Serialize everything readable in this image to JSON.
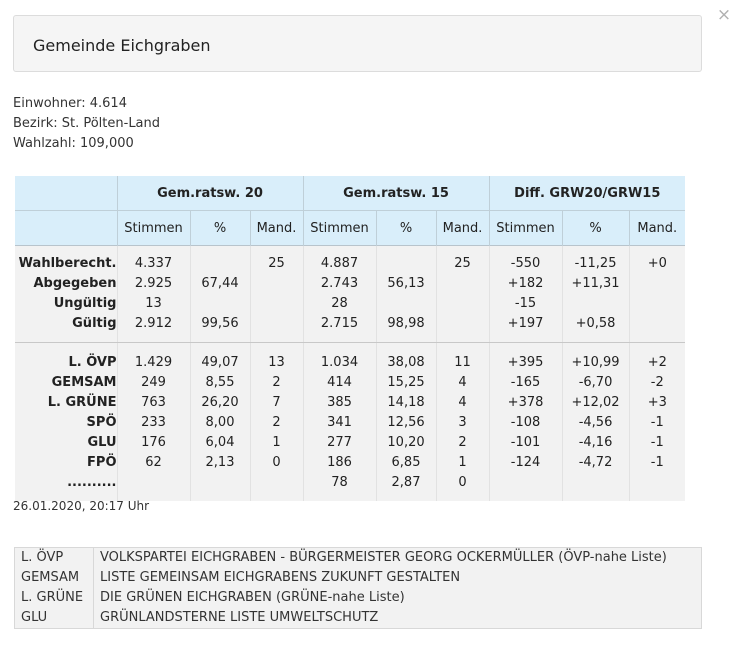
{
  "close_icon": "×",
  "title": "Gemeinde Eichgraben",
  "info": {
    "einwohner": "Einwohner: 4.614",
    "bezirk": "Bezirk: St. Pölten-Land",
    "wahlzahl": "Wahlzahl: 109,000"
  },
  "table": {
    "groups": [
      "Gem.ratsw. 20",
      "Gem.ratsw. 15",
      "Diff. GRW20/GRW15"
    ],
    "columns": [
      "Stimmen",
      "%",
      "Mand.",
      "Stimmen",
      "%",
      "Mand.",
      "Stimmen",
      "%",
      "Mand."
    ],
    "summary_rows": [
      {
        "label": "Wahlberecht.",
        "cells": [
          "4.337",
          "",
          "25",
          "4.887",
          "",
          "25",
          "-550",
          "-11,25",
          "+0"
        ]
      },
      {
        "label": "Abgegeben",
        "cells": [
          "2.925",
          "67,44",
          "",
          "2.743",
          "56,13",
          "",
          "+182",
          "+11,31",
          ""
        ]
      },
      {
        "label": "Ungültig",
        "cells": [
          "13",
          "",
          "",
          "28",
          "",
          "",
          "-15",
          "",
          ""
        ]
      },
      {
        "label": "Gültig",
        "cells": [
          "2.912",
          "99,56",
          "",
          "2.715",
          "98,98",
          "",
          "+197",
          "+0,58",
          ""
        ]
      }
    ],
    "party_rows": [
      {
        "label": "L. ÖVP",
        "cells": [
          "1.429",
          "49,07",
          "13",
          "1.034",
          "38,08",
          "11",
          "+395",
          "+10,99",
          "+2"
        ]
      },
      {
        "label": "GEMSAM",
        "cells": [
          "249",
          "8,55",
          "2",
          "414",
          "15,25",
          "4",
          "-165",
          "-6,70",
          "-2"
        ]
      },
      {
        "label": "L. GRÜNE",
        "cells": [
          "763",
          "26,20",
          "7",
          "385",
          "14,18",
          "4",
          "+378",
          "+12,02",
          "+3"
        ]
      },
      {
        "label": "SPÖ",
        "cells": [
          "233",
          "8,00",
          "2",
          "341",
          "12,56",
          "3",
          "-108",
          "-4,56",
          "-1"
        ]
      },
      {
        "label": "GLU",
        "cells": [
          "176",
          "6,04",
          "1",
          "277",
          "10,20",
          "2",
          "-101",
          "-4,16",
          "-1"
        ]
      },
      {
        "label": "FPÖ",
        "cells": [
          "62",
          "2,13",
          "0",
          "186",
          "6,85",
          "1",
          "-124",
          "-4,72",
          "-1"
        ]
      },
      {
        "label": "..........",
        "cells": [
          "",
          "",
          "",
          "78",
          "2,87",
          "0",
          "",
          "",
          ""
        ]
      }
    ]
  },
  "timestamp": "26.01.2020, 20:17 Uhr",
  "legend": {
    "abbreviations": [
      "L. ÖVP",
      "GEMSAM",
      "L. GRÜNE",
      "GLU"
    ],
    "names": [
      "VOLKSPARTEI EICHGRABEN - BÜRGERMEISTER GEORG OCKERMÜLLER (ÖVP-nahe Liste)",
      "LISTE GEMEINSAM EICHGRABENS ZUKUNFT GESTALTEN",
      "DIE GRÜNEN EICHGRABEN (GRÜNE-nahe Liste)",
      "GRÜNLANDSTERNE LISTE UMWELTSCHUTZ"
    ]
  }
}
